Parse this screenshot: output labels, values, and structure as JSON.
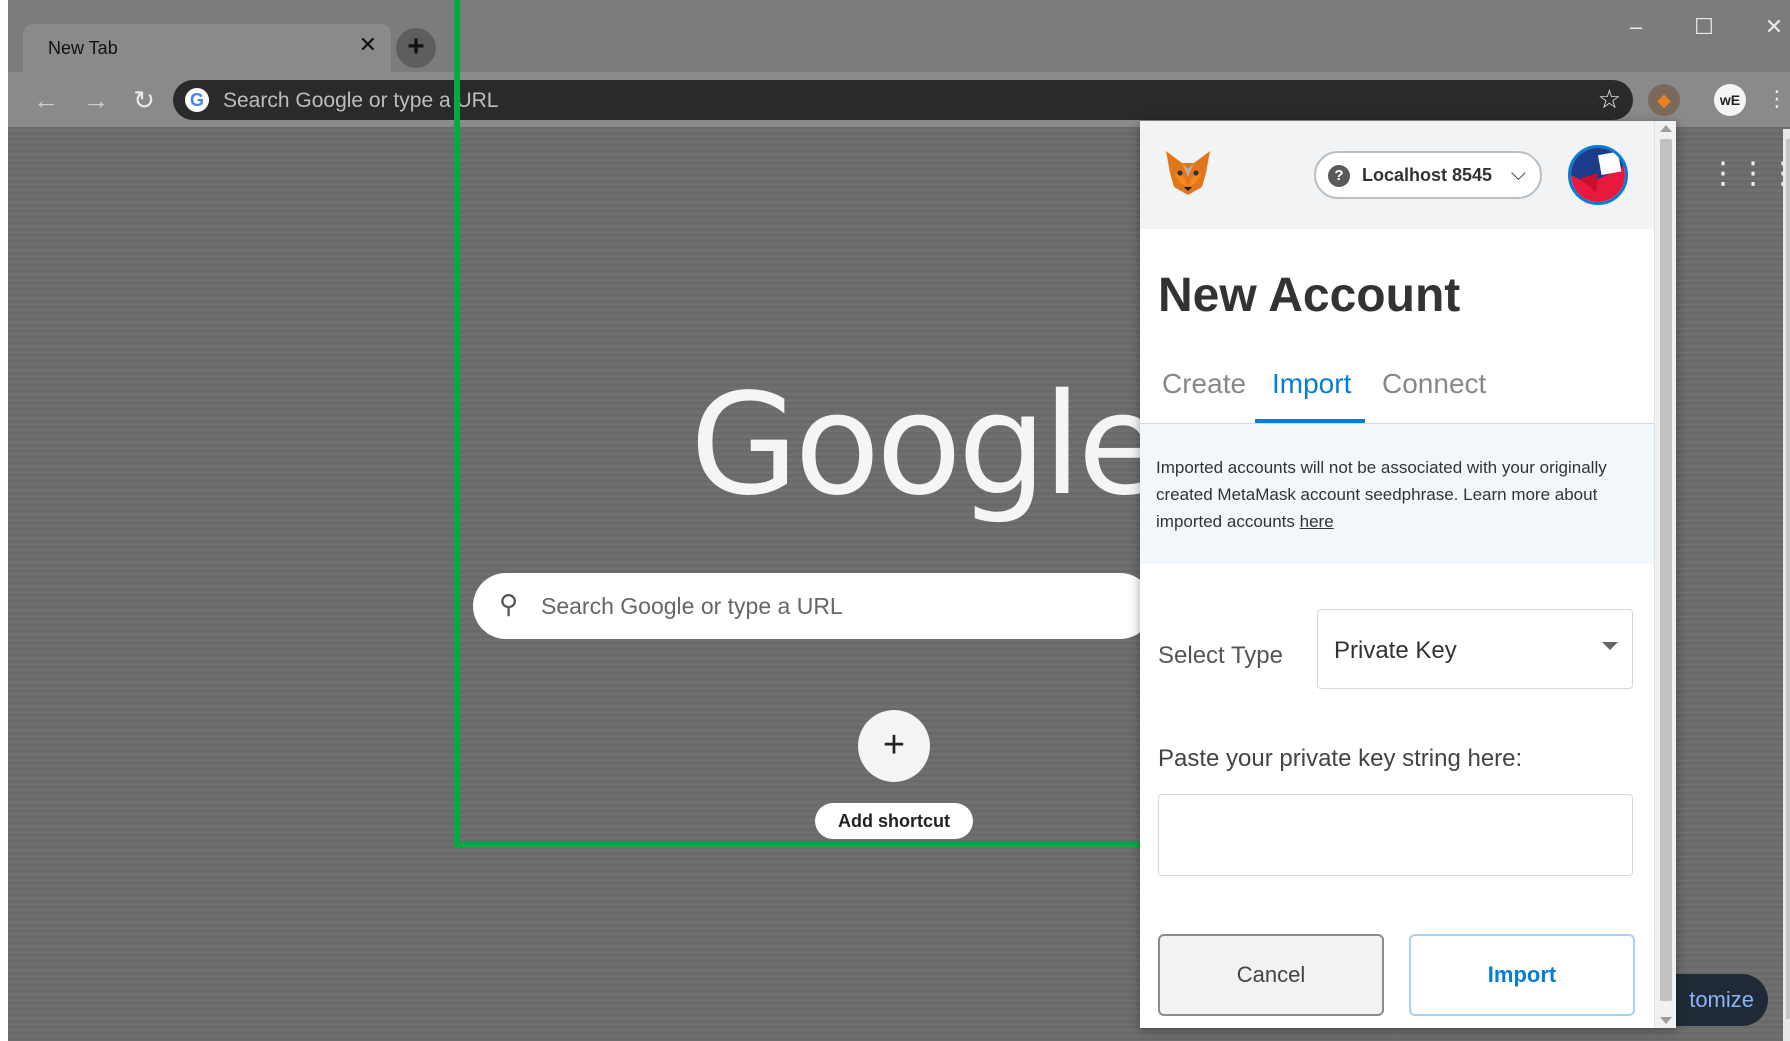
{
  "browser": {
    "tab_title": "New Tab",
    "tab_close_glyph": "✕",
    "new_tab_glyph": "+",
    "omnibox_placeholder": "Search Google or type a URL",
    "window_controls": {
      "minimize": "–",
      "maximize": "☐",
      "close": "✕"
    },
    "extension_we_label": "wE",
    "accent_colors": {
      "chrome_toolbar": "#8a8a8a",
      "omnibox": "#2a2a2a"
    }
  },
  "ntp": {
    "logo_text": "Google",
    "search_placeholder": "Search Google or type a URL",
    "add_shortcut_glyph": "+",
    "add_shortcut_label": "Add shortcut",
    "customize_label": "tomize"
  },
  "annotation": {
    "arrow_color": "#00aa44"
  },
  "metamask": {
    "network_label": "Localhost 8545",
    "network_help_glyph": "?",
    "title": "New Account",
    "tabs": [
      {
        "id": "create",
        "label": "Create",
        "active": false
      },
      {
        "id": "import",
        "label": "Import",
        "active": true
      },
      {
        "id": "connect",
        "label": "Connect",
        "active": false
      }
    ],
    "notice_text": "Imported accounts will not be associated with your originally created MetaMask account seedphrase. Learn more about imported accounts ",
    "notice_link": "here",
    "select_type_label": "Select Type",
    "select_type_value": "Private Key",
    "paste_label": "Paste your private key string here:",
    "private_key_value": "",
    "cancel_label": "Cancel",
    "import_label": "Import",
    "accent_color": "#037dd6"
  }
}
